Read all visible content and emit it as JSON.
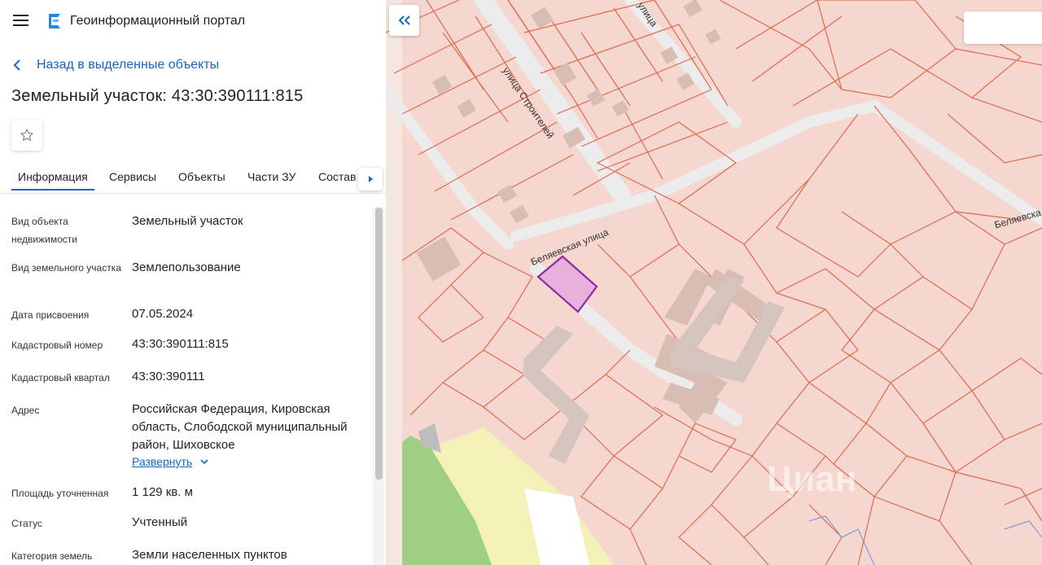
{
  "header": {
    "app_title": "Геоинформационный портал"
  },
  "back_link": {
    "label": "Назад в выделенные объекты"
  },
  "object": {
    "title": "Земельный участок: 43:30:390111:815"
  },
  "tabs": [
    {
      "label": "Информация",
      "active": true
    },
    {
      "label": "Сервисы"
    },
    {
      "label": "Объекты"
    },
    {
      "label": "Части ЗУ"
    },
    {
      "label": "Состав"
    }
  ],
  "fields": [
    {
      "label": "Вид объекта недвижимости",
      "value": "Земельный участок"
    },
    {
      "label": "Вид земельного участка",
      "value": "Землепользование"
    },
    {
      "label": "Дата присвоения",
      "value": "07.05.2024"
    },
    {
      "label": "Кадастровый номер",
      "value": "43:30:390111:815"
    },
    {
      "label": "Кадастровый квартал",
      "value": "43:30:390111"
    },
    {
      "label": "Адрес",
      "value": "Российская Федерация, Кировская область, Слободской муниципальный район, Шиховское"
    },
    {
      "label": "Площадь уточненная",
      "value": "1 129 кв. м"
    },
    {
      "label": "Статус",
      "value": "Учтенный"
    },
    {
      "label": "Категория земель",
      "value": "Земли населенных пунктов"
    }
  ],
  "expand_label": "Развернуть",
  "map": {
    "streets": {
      "stroiteley": "улица Строителей",
      "belyaevskaya": "Беляевская улица",
      "belyaevskaya_right": "Беляевска",
      "top_partial": "улица"
    },
    "watermark": "Циан",
    "colors": {
      "parcel_fill": "#f6d7cf",
      "parcel_border": "#e06a4e",
      "selected_fill": "#e8b0dc",
      "selected_border": "#8a2ea0",
      "road": "#eeeeee",
      "green": "#9fcf82",
      "yellow": "#f4f1b8"
    }
  }
}
